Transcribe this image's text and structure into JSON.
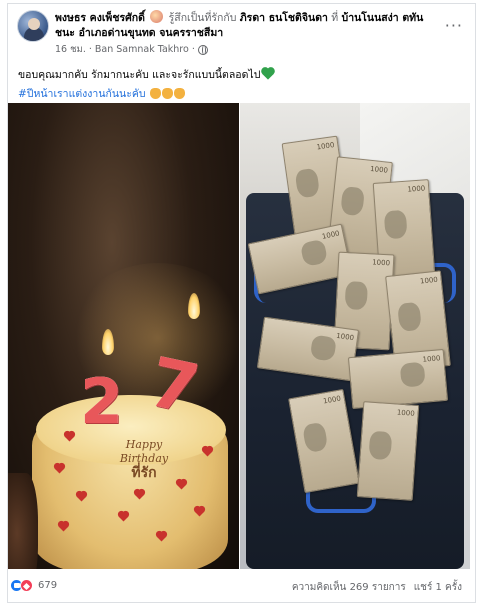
{
  "post": {
    "author": "พงษธร คงเพ็ชรศักดิ์",
    "feeling": "รู้สึกเป็นที่รักกับ",
    "tagged_person": "ภิรดา ธนโชติจินดา",
    "at_word": "ที่",
    "place_line1": "บ้านโนนสง่า ตทัน",
    "place_line2": "ชนะ อำเภอด่านขุนทด จนครราชสีมา",
    "time": "16 ชม.",
    "location": "Ban Samnak Takhro",
    "more": "···",
    "caption": "ขอบคุณมากคับ รักมากนะคับ และจะรักแบบนี้ตลอดไป",
    "hashtag": "#ปีหน้าเราแต่งงานกันนะคับ"
  },
  "photos": {
    "cake": {
      "candle_digits": [
        "2",
        "7"
      ],
      "text_line1": "Happy",
      "text_line2": "Birthday",
      "text_line3": "ที่รัก"
    }
  },
  "footer": {
    "reaction_count": "679",
    "comments": "ความคิดเห็น 269 รายการ",
    "shares": "แชร์ 1 ครั้ง"
  },
  "colors": {
    "link": "#216fdb",
    "like": "#1877f2",
    "love": "#f33e58"
  }
}
